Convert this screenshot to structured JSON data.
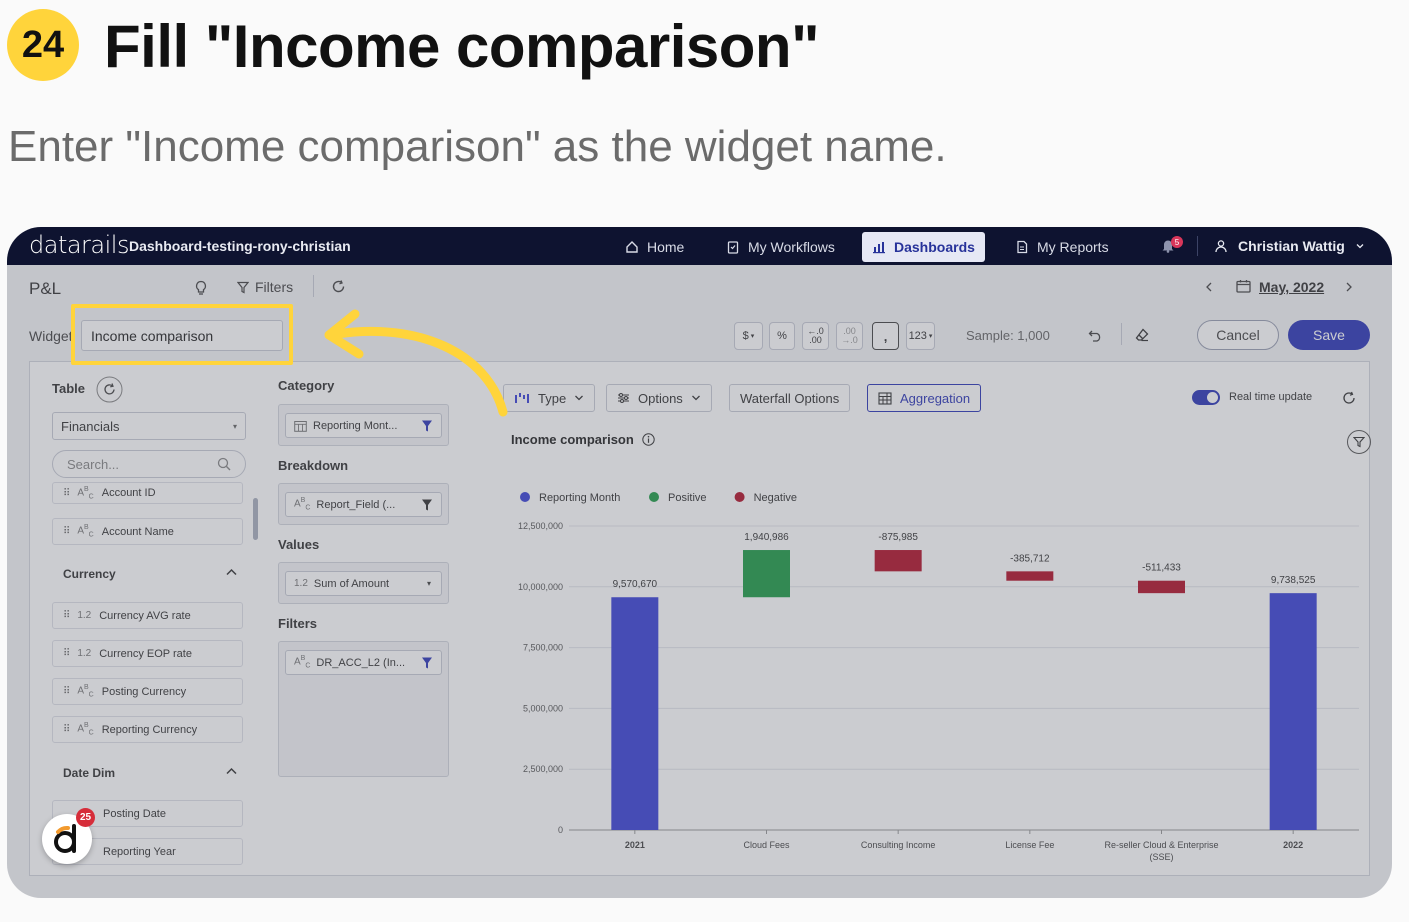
{
  "step": {
    "number": "24",
    "title": "Fill \"Income comparison\"",
    "description": "Enter \"Income comparison\" as the widget name."
  },
  "app": {
    "logo": "datarails",
    "dashboard_name": "Dashboard-testing-rony-christian",
    "nav": [
      {
        "label": "Home",
        "icon": "home-icon"
      },
      {
        "label": "My Workflows",
        "icon": "clipboard-icon"
      },
      {
        "label": "Dashboards",
        "icon": "bar-chart-icon",
        "active": true
      },
      {
        "label": "My Reports",
        "icon": "document-icon"
      }
    ],
    "notification_count": "5",
    "user_name": "Christian Wattig"
  },
  "toolbar": {
    "page_title": "P&L",
    "filters_label": "Filters",
    "date_label": "May, 2022"
  },
  "widget_editor": {
    "name_label": "Widget",
    "name_value": "Income comparison",
    "format_buttons": [
      "$",
      "%",
      "←.0 .00",
      ".00 →.0",
      ",",
      "123"
    ],
    "sample_label": "Sample: 1,000",
    "cancel_label": "Cancel",
    "save_label": "Save"
  },
  "left_panel": {
    "table_label": "Table",
    "table_value": "Financials",
    "search_placeholder": "Search...",
    "fields_top": [
      {
        "type": "ABC",
        "label": "Account ID"
      },
      {
        "type": "ABC",
        "label": "Account Name"
      }
    ],
    "groups": [
      {
        "title": "Currency",
        "fields": [
          {
            "type": "1.2",
            "label": "Currency AVG rate"
          },
          {
            "type": "1.2",
            "label": "Currency EOP rate"
          },
          {
            "type": "ABC",
            "label": "Posting Currency"
          },
          {
            "type": "ABC",
            "label": "Reporting Currency"
          }
        ]
      },
      {
        "title": "Date Dim",
        "fields": [
          {
            "type": "date",
            "label": "Posting Date"
          },
          {
            "type": "1.2",
            "label": "Reporting Year"
          }
        ]
      }
    ]
  },
  "mid_panel": {
    "category_label": "Category",
    "category_chip": "Reporting Mont...",
    "breakdown_label": "Breakdown",
    "breakdown_chip": "Report_Field (...",
    "values_label": "Values",
    "values_chip": "Sum of Amount",
    "values_chip_type": "1.2",
    "filters_label": "Filters",
    "filters_chip": "DR_ACC_L2 (In..."
  },
  "chart_toolbar": {
    "type_label": "Type",
    "options_label": "Options",
    "waterfall_label": "Waterfall Options",
    "aggregation_label": "Aggregation",
    "realtime_label": "Real time update"
  },
  "chart_data": {
    "type": "bar",
    "subtype": "waterfall",
    "title": "Income comparison",
    "legend": [
      {
        "name": "Reporting Month",
        "color": "#3b43d8"
      },
      {
        "name": "Positive",
        "color": "#1f9c47"
      },
      {
        "name": "Negative",
        "color": "#b3132a"
      }
    ],
    "categories": [
      "2021",
      "Cloud Fees",
      "Consulting Income",
      "License Fee",
      "Re-seller Cloud & Enterprise (SSE)",
      "2022"
    ],
    "values": [
      9570670,
      1940986,
      -875985,
      -385712,
      -511433,
      9738525
    ],
    "value_labels": [
      "9,570,670",
      "1,940,986",
      "-875,985",
      "-385,712",
      "-511,433",
      "9,738,525"
    ],
    "kinds": [
      "total",
      "positive",
      "negative",
      "negative",
      "negative",
      "total"
    ],
    "y_ticks": [
      "0",
      "2,500,000",
      "5,000,000",
      "7,500,000",
      "10,000,000",
      "12,500,000"
    ],
    "ylim": [
      0,
      12500000
    ],
    "grid": true,
    "legend_position": "top-left"
  },
  "user_avatar_badge": "25"
}
